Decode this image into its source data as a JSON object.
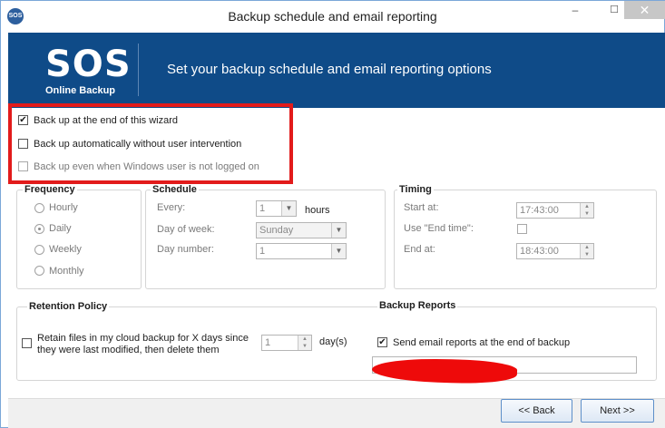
{
  "window": {
    "title": "Backup schedule and email reporting",
    "app_icon": "SOS",
    "controls": {
      "minimize": "–",
      "maximize": "☐",
      "close": "✕"
    }
  },
  "banner": {
    "logo_text": "SOS",
    "logo_subtext": "Online Backup",
    "heading": "Set your backup schedule and email reporting options"
  },
  "options": [
    {
      "label": "Back up at the end of this wizard",
      "checked": true,
      "enabled": true
    },
    {
      "label": "Back up automatically without user intervention",
      "checked": false,
      "enabled": true
    },
    {
      "label": "Back up even when Windows user is not logged on",
      "checked": false,
      "enabled": false
    }
  ],
  "frequency": {
    "title": "Frequency",
    "items": [
      "Hourly",
      "Daily",
      "Weekly",
      "Monthly"
    ],
    "selected": "Daily"
  },
  "schedule": {
    "title": "Schedule",
    "every_label": "Every:",
    "every_value": "1",
    "every_unit": "hours",
    "day_of_week_label": "Day of week:",
    "day_of_week_value": "Sunday",
    "day_number_label": "Day number:",
    "day_number_value": "1"
  },
  "timing": {
    "title": "Timing",
    "start_label": "Start at:",
    "start_value": "17:43:00",
    "use_end_label": "Use \"End time\":",
    "end_label": "End at:",
    "end_value": "18:43:00"
  },
  "retention": {
    "title": "Retention Policy",
    "label_line1": "Retain files in my cloud backup for X days since",
    "label_line2": "they were last modified, then delete them",
    "days_value": "1",
    "days_unit": "day(s)"
  },
  "reports": {
    "title": "Backup Reports",
    "send_label": "Send email reports at the end of backup",
    "send_checked": true
  },
  "footer": {
    "back_label": "<< Back",
    "next_label": "Next >>"
  },
  "colors": {
    "banner": "#0f4b88",
    "highlight": "#e21b1b"
  }
}
